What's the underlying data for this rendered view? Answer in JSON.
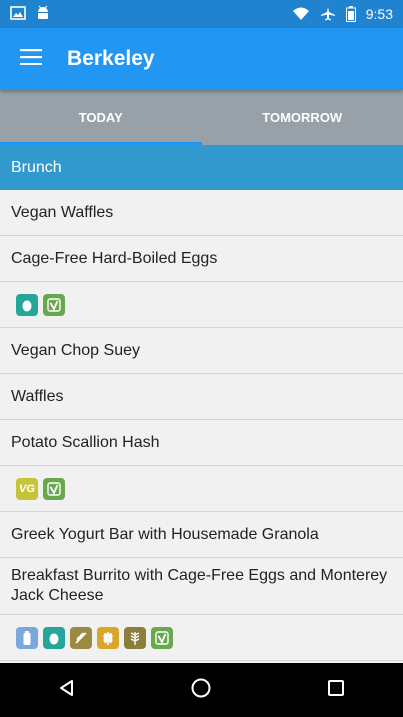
{
  "status_bar": {
    "time": "9:53",
    "left_icons": [
      "image-icon",
      "android-icon"
    ],
    "right_icons": [
      "wifi-icon",
      "airplane-icon",
      "battery-icon"
    ]
  },
  "app_bar": {
    "title": "Berkeley",
    "menu_icon": "menu-icon"
  },
  "tabs": [
    {
      "label": "TODAY",
      "active": true
    },
    {
      "label": "TOMORROW",
      "active": false
    }
  ],
  "menu": {
    "section": "Brunch",
    "items": [
      "Vegan Waffles",
      "Cage-Free Hard-Boiled Eggs",
      "Vegan Chop Suey",
      "Waffles",
      "Potato Scallion Hash",
      "Greek Yogurt Bar with Housemade Granola",
      "Breakfast Burrito with Cage-Free Eggs and Monterey Jack Cheese"
    ],
    "icon_rows": [
      [
        "egg-icon",
        "vegetarian-icon"
      ],
      [
        "vegan-icon",
        "vegetarian-icon"
      ],
      [
        "milk-icon",
        "egg-icon",
        "wheat-icon",
        "gluten-icon",
        "grain-icon",
        "vegetarian-icon"
      ]
    ],
    "icon_labels": {
      "vegan": "VG"
    }
  },
  "colors": {
    "status_bar": "#1f83cf",
    "app_bar": "#2196f3",
    "tabs_bg": "#97a1a7",
    "section_header": "#3199cd",
    "egg_icon": "#26a69a",
    "vegetarian_icon": "#6aa84f",
    "vegan_icon": "#c5c43a",
    "milk_icon": "#7aa7dd",
    "grain_icon": "#8b7d3a"
  },
  "nav_bar": {
    "buttons": [
      "back-icon",
      "home-icon",
      "recents-icon"
    ]
  }
}
